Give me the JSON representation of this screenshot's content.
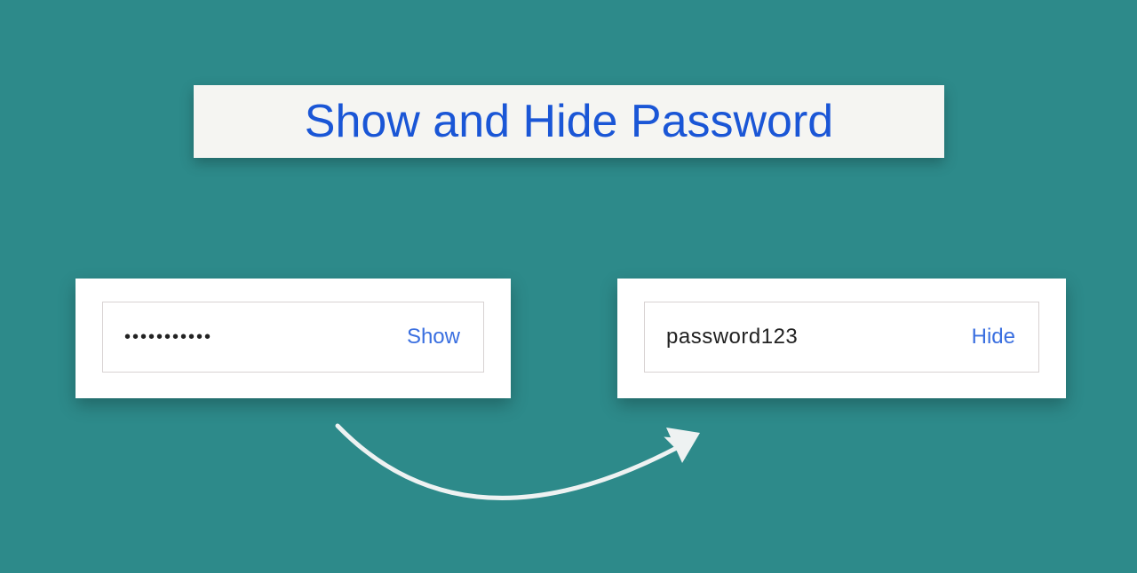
{
  "title": "Show and Hide Password",
  "leftCard": {
    "maskedValue": "•••••••••••",
    "toggleLabel": "Show"
  },
  "rightCard": {
    "revealedValue": "password123",
    "toggleLabel": "Hide"
  }
}
